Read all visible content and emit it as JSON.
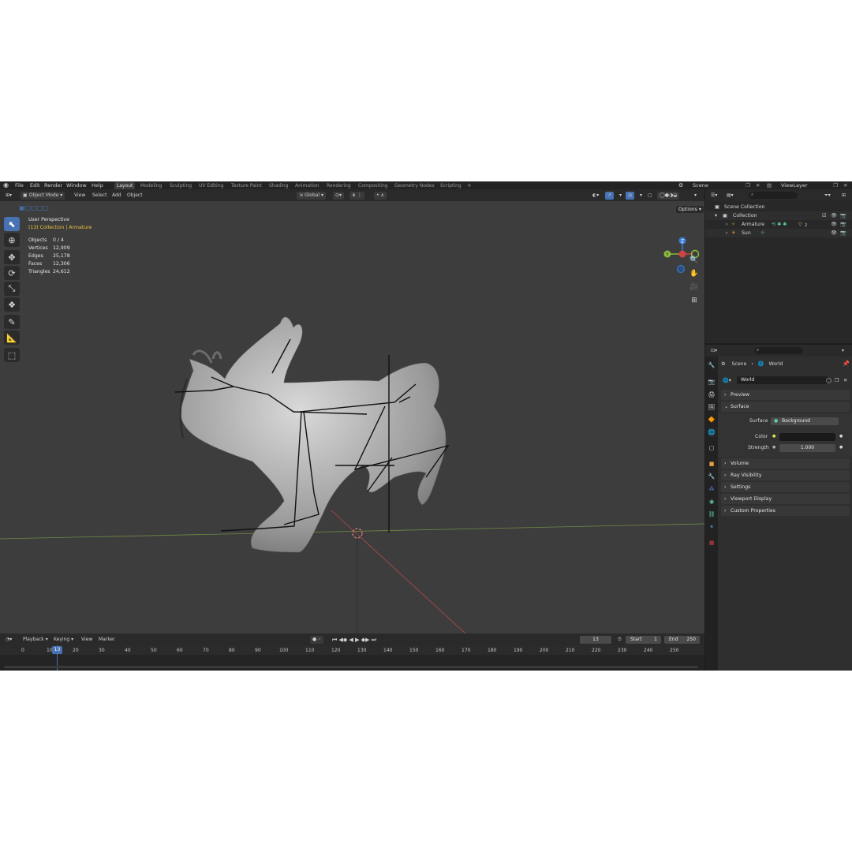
{
  "menu": [
    "File",
    "Edit",
    "Render",
    "Window",
    "Help"
  ],
  "workspaces": [
    "Layout",
    "Modeling",
    "Sculpting",
    "UV Editing",
    "Texture Paint",
    "Shading",
    "Animation",
    "Rendering",
    "Compositing",
    "Geometry Nodes",
    "Scripting"
  ],
  "active_workspace": "Layout",
  "add_tab": "+",
  "scene_name": "Scene",
  "view_layer": "ViewLayer",
  "viewport_header": {
    "mode": "Object Mode",
    "view": "View",
    "select": "Select",
    "add": "Add",
    "object": "Object",
    "orientation": "Global",
    "options": "Options"
  },
  "viewport_info": {
    "perspective": "User Perspective",
    "context": "(13) Collection | Armature",
    "stats": [
      {
        "label": "Objects",
        "value": "0 / 4"
      },
      {
        "label": "Vertices",
        "value": "12,909"
      },
      {
        "label": "Edges",
        "value": "25,178"
      },
      {
        "label": "Faces",
        "value": "12,306"
      },
      {
        "label": "Triangles",
        "value": "24,612"
      }
    ]
  },
  "gizmo": {
    "z": "Z",
    "y": "Y"
  },
  "timeline": {
    "playback": "Playback",
    "keying": "Keying",
    "view": "View",
    "marker": "Marker",
    "current_frame": "13",
    "start_label": "Start",
    "start": "1",
    "end_label": "End",
    "end": "250",
    "ruler": [
      "0",
      "10",
      "20",
      "30",
      "40",
      "50",
      "60",
      "70",
      "80",
      "90",
      "100",
      "110",
      "120",
      "130",
      "140",
      "150",
      "160",
      "170",
      "180",
      "190",
      "200",
      "210",
      "220",
      "230",
      "240",
      "250"
    ]
  },
  "outliner": {
    "scene_collection": "Scene Collection",
    "collection": "Collection",
    "items": [
      {
        "name": "Armature",
        "badge": "2"
      },
      {
        "name": "Sun"
      }
    ]
  },
  "properties": {
    "breadcrumb_scene": "Scene",
    "breadcrumb_world": "World",
    "world_name": "World",
    "panels": {
      "preview": "Preview",
      "surface": "Surface",
      "volume": "Volume",
      "ray_visibility": "Ray Visibility",
      "settings": "Settings",
      "viewport_display": "Viewport Display",
      "custom_properties": "Custom Properties"
    },
    "surface_label": "Surface",
    "surface_value": "Background",
    "color_label": "Color",
    "strength_label": "Strength",
    "strength_value": "1.000"
  },
  "colors": {
    "accent": "#4772b3",
    "viewport_bg": "#3d3d3d",
    "context_text": "#e8c23a",
    "x_axis": "#c44",
    "y_axis": "#8dbb3c",
    "z_axis": "#3b7fd8"
  }
}
